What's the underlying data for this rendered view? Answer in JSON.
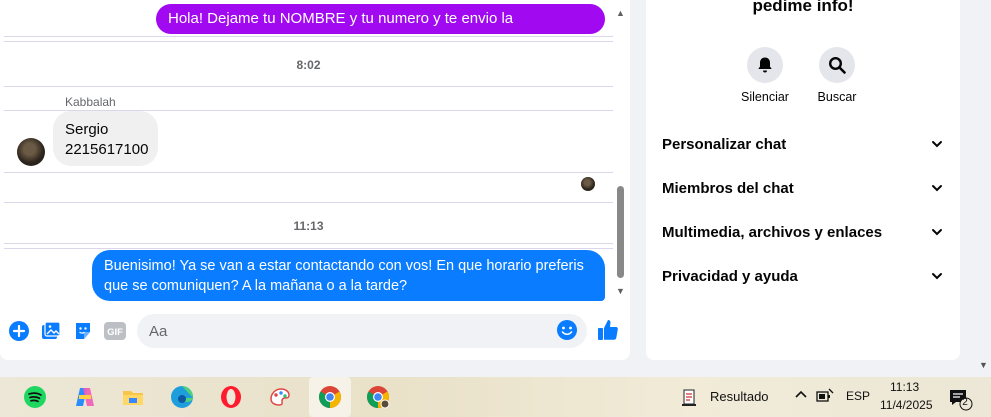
{
  "chat": {
    "messages": {
      "outgoing_1": "Hola! Dejame tu NOMBRE y tu numero y te envio la informacion",
      "time_1": "8:02",
      "sender_name": "Kabbalah",
      "incoming_line1": "Sergio",
      "incoming_line2": "2215617100",
      "time_2": "11:13",
      "outgoing_2_line1": "Buenisimo! Ya se van a estar contactando con vos! En que horario preferis",
      "outgoing_2_line2": "que se comuniquen? A la mañana o a la tarde?"
    },
    "composer": {
      "placeholder": "Aa",
      "icons": [
        "plus-icon",
        "image-icon",
        "sticker-icon",
        "gif-icon",
        "emoji-icon",
        "like-icon"
      ],
      "gif_label": "GIF"
    },
    "colors": {
      "outgoing_purple": "#a109f0",
      "outgoing_blue": "#0a7cff",
      "incoming": "#f0f0f0",
      "accent": "#0a7cff"
    }
  },
  "info_panel": {
    "title": "pedime info!",
    "actions": [
      {
        "label": "Silenciar",
        "icon": "bell-icon"
      },
      {
        "label": "Buscar",
        "icon": "search-icon"
      }
    ],
    "sections": [
      "Personalizar chat",
      "Miembros del chat",
      "Multimedia, archivos y enlaces",
      "Privacidad y ayuda"
    ]
  },
  "taskbar": {
    "apps": [
      "spotify-icon",
      "copilot-icon",
      "file-explorer-icon",
      "edge-icon",
      "opera-icon",
      "paint-icon",
      "chrome-icon",
      "chrome-profile-icon"
    ],
    "notification_label": "Resultado",
    "language": "ESP",
    "time": "11:13",
    "date": "11/4/2025",
    "notification_count": "2"
  }
}
